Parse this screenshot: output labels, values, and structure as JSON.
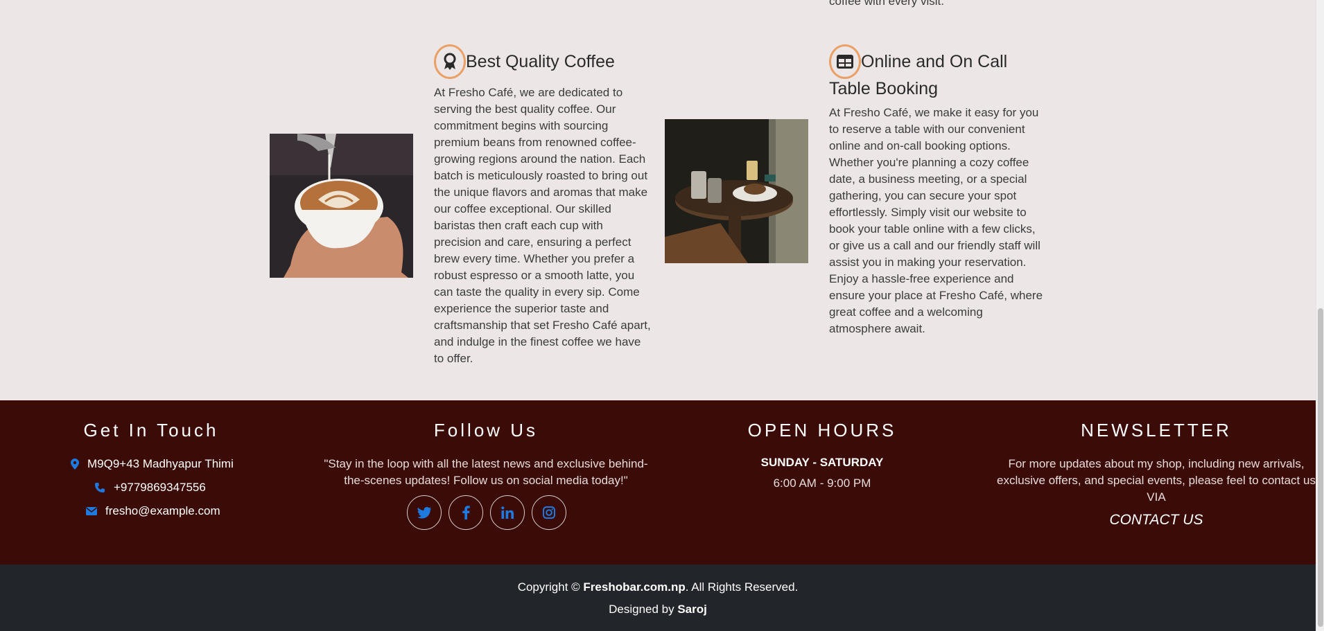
{
  "top_fragment": "coffee with every visit.",
  "features": [
    {
      "title": "Best Quality Coffee",
      "icon": "award-icon",
      "image": "latte-art-cup",
      "lines": [
        "At Fresho Café, we are dedicated to",
        "serving the best quality coffee. Our",
        "commitment begins with sourcing",
        "premium beans from renowned coffee-",
        "growing regions around the nation. Each",
        "batch is meticulously roasted to bring out",
        "the unique flavors and aromas that make",
        "our coffee exceptional. Our skilled",
        "baristas then craft each cup with",
        "precision and care, ensuring a perfect",
        "brew every time. Whether you prefer a",
        "robust espresso or a smooth latte, you",
        "can taste the quality in every sip. Come",
        "experience the superior taste and",
        "craftsmanship that set Fresho Café apart,",
        "and indulge in the finest coffee we have",
        "to offer."
      ]
    },
    {
      "title_line1": "Online and On Call",
      "title_line2": "Table Booking",
      "icon": "table-icon",
      "image": "cafe-table-with-coffee",
      "lines": [
        "At Fresho Café, we make it easy for you",
        "to reserve a table with our convenient",
        "online and on-call booking options.",
        "Whether you're planning a cozy coffee",
        "date, a business meeting, or a special",
        "gathering, you can secure your spot",
        "effortlessly. Simply visit our website to",
        "book your table online with a few clicks,",
        "or give us a call and our friendly staff will",
        "assist you in making your reservation.",
        "Enjoy a hassle-free experience and",
        "ensure your place at Fresho Café, where",
        "great coffee and a welcoming",
        "atmosphere await."
      ]
    }
  ],
  "footer": {
    "touch": {
      "heading": "Get In Touch",
      "address": "M9Q9+43 Madhyapur Thimi",
      "phone": "+9779869347556",
      "email": "fresho@example.com"
    },
    "follow": {
      "heading": "Follow Us",
      "text_line1": "\"Stay in the loop with all the latest news and exclusive behind-",
      "text_line2": "the-scenes updates! Follow us on social media today!\"",
      "socials": [
        "twitter-icon",
        "facebook-icon",
        "linkedin-icon",
        "instagram-icon"
      ]
    },
    "hours": {
      "heading": "OPEN HOURS",
      "days": "SUNDAY - SATURDAY",
      "time": "6:00 AM - 9:00 PM"
    },
    "newsletter": {
      "heading": "NEWSLETTER",
      "text_line1": "For more updates about my shop, including new arrivals,",
      "text_line2": "exclusive offers, and special events, please feel to contact us",
      "text_line3": "VIA",
      "contact_label": "CONTACT US"
    }
  },
  "bottom": {
    "copyright_prefix": "Copyright © ",
    "site": "Freshobar.com.np",
    "copyright_suffix": ". All Rights Reserved.",
    "designed_prefix": "Designed by ",
    "designer": "Saroj"
  },
  "colors": {
    "page_bg": "#ece6e6",
    "footer_bg": "#3a0b07",
    "bottom_bg": "#22252a",
    "accent_ring": "#e9a168",
    "icon_blue": "#1f7ae0"
  }
}
